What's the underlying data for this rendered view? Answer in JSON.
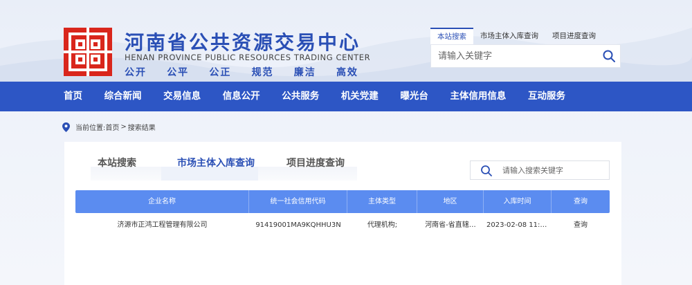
{
  "site": {
    "title": "河南省公共资源交易中心",
    "subtitle": "HENAN PROVINCE PUBLIC RESOURCES TRADING CENTER",
    "slogan": [
      "公开",
      "公平",
      "公正",
      "规范",
      "廉洁",
      "高效"
    ],
    "brand_color": "#2a4fb5",
    "logo_color": "#d9261c"
  },
  "top_search": {
    "tabs": [
      "本站搜索",
      "市场主体入库查询",
      "项目进度查询"
    ],
    "active_tab": 0,
    "placeholder": "请输入关键字"
  },
  "nav": {
    "color": "#2d56c5",
    "items": [
      "首页",
      "综合新闻",
      "交易信息",
      "信息公开",
      "公共服务",
      "机关党建",
      "曝光台",
      "主体信用信息",
      "互动服务"
    ]
  },
  "breadcrumb": {
    "prefix": "当前位置:",
    "items": [
      "首页",
      "搜索结果"
    ],
    "separator": ">"
  },
  "panel": {
    "tabs": [
      "本站搜索",
      "市场主体入库查询",
      "项目进度查询"
    ],
    "active_tab": 1,
    "search_placeholder": "请输入搜索关键字",
    "table": {
      "header_color": "#5b8cf0",
      "columns": [
        "企业名称",
        "统一社会信用代码",
        "主体类型",
        "地区",
        "入库时间",
        "查询"
      ],
      "rows": [
        [
          "济源市正鸿工程管理有限公司",
          "91419001MA9KQHHU3N",
          "代理机构;",
          "河南省-省直辖…",
          "2023-02-08 11:4…",
          "查询"
        ]
      ]
    }
  }
}
